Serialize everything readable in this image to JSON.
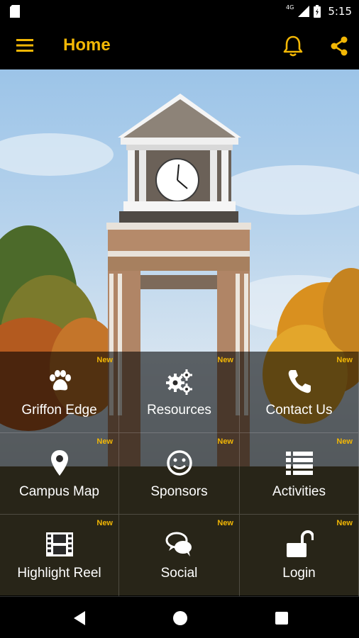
{
  "status_bar": {
    "time": "5:15",
    "network": "4G",
    "icons": [
      "sim-card-icon",
      "signal-icon",
      "battery-icon"
    ]
  },
  "app_bar": {
    "title": "Home",
    "icons": [
      "menu-icon",
      "bell-icon",
      "share-icon"
    ],
    "accent_color": "#f2b705"
  },
  "tiles": [
    {
      "label": "Griffon Edge",
      "badge": "New",
      "icon": "paw-icon"
    },
    {
      "label": "Resources",
      "badge": "New",
      "icon": "gears-icon"
    },
    {
      "label": "Contact Us",
      "badge": "New",
      "icon": "phone-icon"
    },
    {
      "label": "Campus Map",
      "badge": "New",
      "icon": "map-pin-icon"
    },
    {
      "label": "Sponsors",
      "badge": "New",
      "icon": "smiley-icon"
    },
    {
      "label": "Activities",
      "badge": "New",
      "icon": "list-icon"
    },
    {
      "label": "Highlight Reel",
      "badge": "New",
      "icon": "film-icon"
    },
    {
      "label": "Social",
      "badge": "New",
      "icon": "chat-bubbles-icon"
    },
    {
      "label": "Login",
      "badge": "New",
      "icon": "unlock-icon"
    }
  ],
  "nav_bar": {
    "icons": [
      "back-icon",
      "home-icon",
      "recent-apps-icon"
    ]
  }
}
